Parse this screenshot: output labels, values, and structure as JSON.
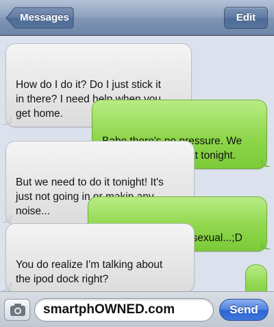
{
  "navbar": {
    "back_label": "Messages",
    "edit_label": "Edit"
  },
  "messages": [
    {
      "direction": "incoming",
      "text": "How do I do it? Do I just stick it\nin there? I need help when you\nget home."
    },
    {
      "direction": "outgoing",
      "text": "Babe there's no pressure. We\ndon't have to do that tonight."
    },
    {
      "direction": "incoming",
      "text": "But we need to do it tonight! It's\njust not going in or makin any\nnoise..."
    },
    {
      "direction": "outgoing",
      "text": "Well we can fix that sexual...;D"
    },
    {
      "direction": "incoming",
      "text": "You do realize I'm talking about\nthe ipod dock right?"
    },
    {
      "direction": "outgoing",
      "text": "..."
    }
  ],
  "compose": {
    "input_value": "smartphOWNED.com",
    "send_label": "Send",
    "camera_icon": "camera-icon"
  },
  "colors": {
    "incoming_bubble": "#e6e6e6",
    "outgoing_bubble": "#8fd64c",
    "thread_background": "#dbe2ed",
    "navbar": "#7f95b4",
    "send_button": "#3e76dc"
  }
}
